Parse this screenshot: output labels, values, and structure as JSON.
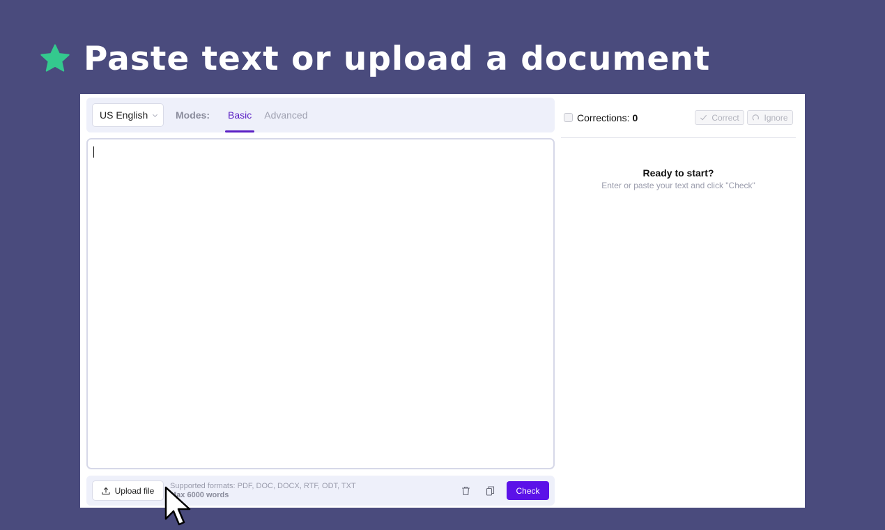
{
  "slide": {
    "title": "Paste text or upload a document",
    "star_icon": "star-icon",
    "background_color": "#4a4b7d",
    "star_color": "#34c98e"
  },
  "toolbar": {
    "language": "US English",
    "modes_label": "Modes:",
    "tabs": [
      {
        "label": "Basic",
        "active": true
      },
      {
        "label": "Advanced",
        "active": false
      }
    ]
  },
  "editor": {
    "text": ""
  },
  "bottom_bar": {
    "upload_label": "Upload file",
    "formats": "Supported formats: PDF, DOC, DOCX, RTF, ODT, TXT",
    "max_words": "Max 6000 words",
    "check_label": "Check",
    "accent_color": "#5b12e8"
  },
  "corrections": {
    "label": "Corrections:",
    "count": "0",
    "correct_label": "Correct",
    "ignore_label": "Ignore"
  },
  "empty_state": {
    "title": "Ready to start?",
    "subtitle": "Enter or paste your text and click \"Check\""
  }
}
